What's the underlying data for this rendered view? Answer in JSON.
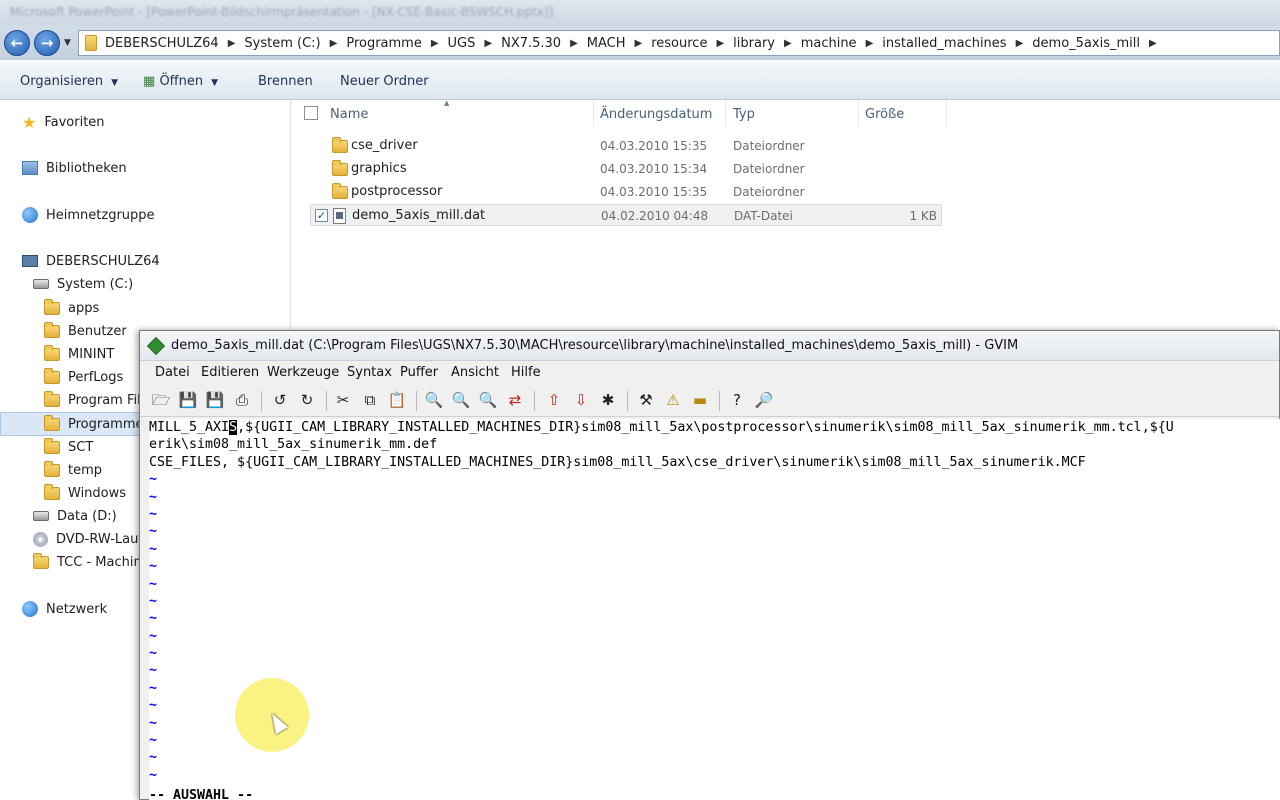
{
  "window": {
    "title": "Microsoft PowerPoint - [PowerPoint-Bildschirmpräsentation - [NX-CSE-Basic-BSWSCH.pptx]]"
  },
  "address": {
    "crumbs": [
      "DEBERSCHULZ64",
      "System (C:)",
      "Programme",
      "UGS",
      "NX7.5.30",
      "MACH",
      "resource",
      "library",
      "machine",
      "installed_machines",
      "demo_5axis_mill"
    ]
  },
  "toolbar": {
    "organize": "Organisieren",
    "open": "Öffnen",
    "burn": "Brennen",
    "new_folder": "Neuer Ordner"
  },
  "navpane": {
    "favorites": "Favoriten",
    "libraries": "Bibliotheken",
    "homegroup": "Heimnetzgruppe",
    "computer": "DEBERSCHULZ64",
    "system_drive": "System (C:)",
    "folders": [
      "apps",
      "Benutzer",
      "MININT",
      "PerfLogs",
      "Program Files",
      "Programme",
      "SCT",
      "temp",
      "Windows"
    ],
    "data_drive": "Data (D:)",
    "dvd_drive": "DVD-RW-Laufwerk",
    "tcc": "TCC - Machine",
    "network": "Netzwerk"
  },
  "columns": {
    "name": "Name",
    "date": "Änderungsdatum",
    "type": "Typ",
    "size": "Größe"
  },
  "files": [
    {
      "name": "cse_driver",
      "date": "04.03.2010 15:35",
      "type": "Dateiordner",
      "size": ""
    },
    {
      "name": "graphics",
      "date": "04.03.2010 15:34",
      "type": "Dateiordner",
      "size": ""
    },
    {
      "name": "postprocessor",
      "date": "04.03.2010 15:35",
      "type": "Dateiordner",
      "size": ""
    },
    {
      "name": "demo_5axis_mill.dat",
      "date": "04.02.2010 04:48",
      "type": "DAT-Datei",
      "size": "1 KB"
    }
  ],
  "gvim": {
    "title": "demo_5axis_mill.dat (C:\\Program Files\\UGS\\NX7.5.30\\MACH\\resource\\library\\machine\\installed_machines\\demo_5axis_mill) - GVIM",
    "menu": [
      "Datei",
      "Editieren",
      "Werkzeuge",
      "Syntax",
      "Puffer",
      "Ansicht",
      "Hilfe"
    ],
    "line1_pre": "MILL_5_AXI",
    "line1_cursor": "S",
    "line1_post": ",${UGII_CAM_LIBRARY_INSTALLED_MACHINES_DIR}sim08_mill_5ax\\postprocessor\\sinumerik\\sim08_mill_5ax_sinumerik_mm.tcl,${U",
    "line2": "erik\\sim08_mill_5ax_sinumerik_mm.def",
    "line3": "CSE_FILES, ${UGII_CAM_LIBRARY_INSTALLED_MACHINES_DIR}sim08_mill_5ax\\cse_driver\\sinumerik\\sim08_mill_5ax_sinumerik.MCF",
    "tilde": "~",
    "status": "-- AUSWAHL --"
  },
  "colors": {
    "accent": "#1f5cb0",
    "vim_tilde": "#0000ff",
    "mouse_highlight": "#faf06e"
  }
}
